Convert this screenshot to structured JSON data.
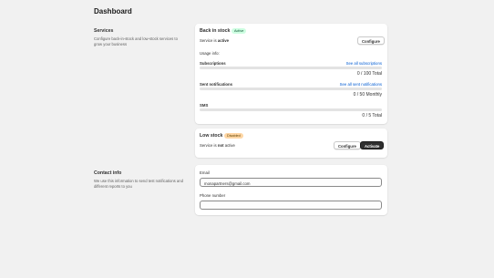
{
  "page": {
    "title": "Dashboard"
  },
  "services": {
    "title": "Services",
    "description": "Configure back-in-stock and low-stock services to grow your business"
  },
  "back_in_stock": {
    "title": "Back in stock",
    "badge": "Active",
    "status_prefix": "Service is",
    "status_value": "active",
    "configure_label": "Configure",
    "usage_info_label": "Usage info:",
    "subscriptions": {
      "label": "Subscriptions",
      "link": "See all subscriptions",
      "count": "0 / 100 Total",
      "progress": 0
    },
    "sent_notifications": {
      "label": "Sent notifications",
      "link": "See all sent notifications",
      "count": "0 / 50 Monthly",
      "progress": 0
    },
    "sms": {
      "label": "SMS",
      "count": "0 / 5 Total",
      "progress": 0
    }
  },
  "low_stock": {
    "title": "Low stock",
    "badge": "Disabled",
    "status_prefix": "Service is",
    "status_value": "not",
    "status_suffix": "active",
    "configure_label": "Configure",
    "activate_label": "Activate"
  },
  "contact": {
    "title": "Contact info",
    "description": "We use this information to send test notifications and different reports to you",
    "email_label": "Email",
    "email_value": "monapartners@gmail.com",
    "phone_label": "Phone number",
    "phone_value": ""
  },
  "colors": {
    "accent_link": "#005bd3",
    "badge_active_bg": "#cdfee1",
    "badge_disabled_bg": "#ffd6a4",
    "primary_button": "#303030"
  }
}
